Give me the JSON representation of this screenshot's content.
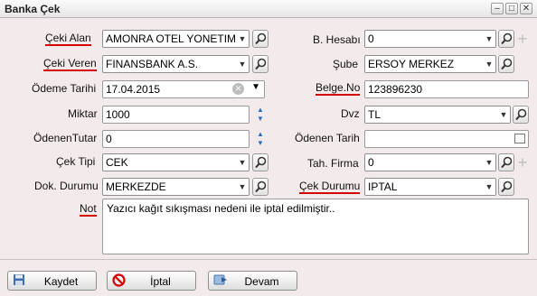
{
  "window": {
    "title": "Banka Çek",
    "minimize": "–",
    "maximize": "□",
    "close": "✕"
  },
  "left": {
    "ceki_alan": {
      "label": "Çeki Alan",
      "value": "AMONRA OTEL YONETIM Y"
    },
    "ceki_veren": {
      "label": "Çeki Veren",
      "value": "FINANSBANK A.S."
    },
    "odeme_tarihi": {
      "label": "Ödeme Tarihi",
      "value": "17.04.2015"
    },
    "miktar": {
      "label": "Miktar",
      "value": "1000"
    },
    "odenen_tutar": {
      "label": "ÖdenenTutar",
      "value": "0"
    },
    "cek_tipi": {
      "label": "Çek Tipi",
      "value": "CEK"
    },
    "dok_durumu": {
      "label": "Dok. Durumu",
      "value": "MERKEZDE"
    }
  },
  "right": {
    "b_hesabi": {
      "label": "B. Hesabı",
      "value": "0"
    },
    "sube": {
      "label": "Şube",
      "value": "ERSOY MERKEZ"
    },
    "belge_no": {
      "label": "Belge.No",
      "value": "123896230"
    },
    "dvz": {
      "label": "Dvz",
      "value": "TL"
    },
    "odenen_tarih": {
      "label": "Ödenen Tarih",
      "value": ""
    },
    "tah_firma": {
      "label": "Tah. Firma",
      "value": "0"
    },
    "cek_durumu": {
      "label": "Çek Durumu",
      "value": "IPTAL"
    }
  },
  "not": {
    "label": "Not",
    "value": "Yazıcı kağıt sıkışması nedeni ile iptal edilmiştir.."
  },
  "footer": {
    "kaydet": "Kaydet",
    "iptal": "İptal",
    "devam": "Devam"
  },
  "colors": {
    "underline": "#d40000",
    "background": "#f3ebeb",
    "spin_arrow": "#2a6ebd"
  }
}
